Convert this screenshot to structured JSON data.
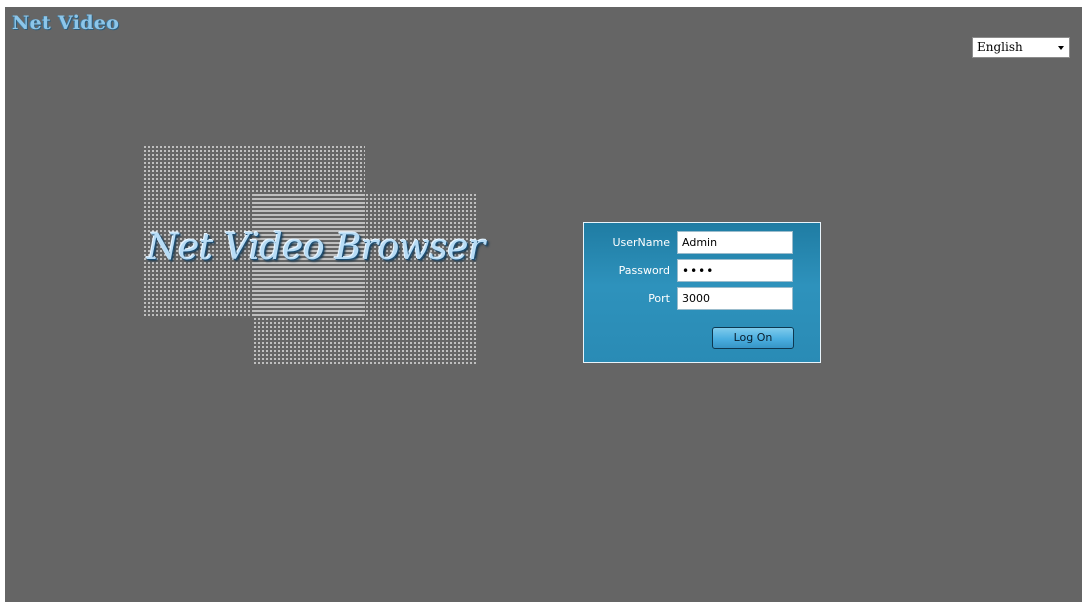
{
  "app": {
    "brand": "Net Video",
    "hero_title": "Net Video Browser"
  },
  "language": {
    "selected": "English"
  },
  "login": {
    "username_label": "UserName",
    "username_value": "Admin",
    "password_label": "Password",
    "password_value": "••••",
    "port_label": "Port",
    "port_value": "3000",
    "logon_button": "Log On"
  },
  "colors": {
    "background": "#656565",
    "brand_text": "#8cc6ea",
    "panel": "#2e92bc",
    "button": "#4aaee0"
  },
  "icons": {
    "language_dropdown": "chevron-down-icon"
  }
}
